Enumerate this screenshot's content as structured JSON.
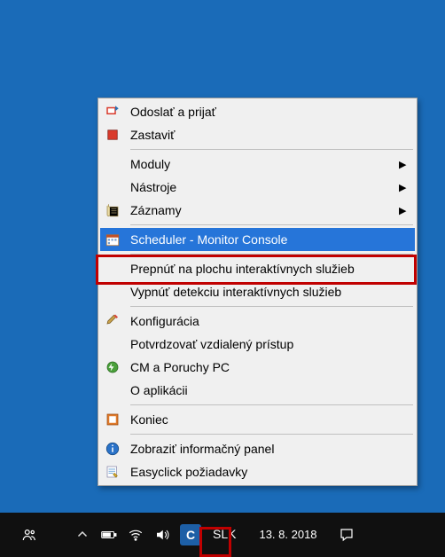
{
  "menu": {
    "items": [
      {
        "label": "Odoslať a prijať",
        "icon": "send-receive-icon",
        "submenu": false
      },
      {
        "label": "Zastaviť",
        "icon": "stop-icon",
        "submenu": false
      },
      "sep",
      {
        "label": "Moduly",
        "icon": null,
        "submenu": true
      },
      {
        "label": "Nástroje",
        "icon": null,
        "submenu": true
      },
      {
        "label": "Záznamy",
        "icon": "logs-icon",
        "submenu": true
      },
      "sep",
      {
        "label": "Scheduler - Monitor Console",
        "icon": "scheduler-icon",
        "submenu": false,
        "selected": true
      },
      "sep",
      {
        "label": "Prepnúť na plochu interaktívnych služieb",
        "icon": null,
        "submenu": false
      },
      {
        "label": "Vypnúť detekciu interaktívnych služieb",
        "icon": null,
        "submenu": false
      },
      "sep",
      {
        "label": "Konfigurácia",
        "icon": "config-icon",
        "submenu": false
      },
      {
        "label": "Potvrdzovať vzdialený prístup",
        "icon": null,
        "submenu": false
      },
      {
        "label": "CM a Poruchy PC",
        "icon": "cm-icon",
        "submenu": false
      },
      {
        "label": "O aplikácii",
        "icon": null,
        "submenu": false
      },
      "sep",
      {
        "label": "Koniec",
        "icon": "exit-icon",
        "submenu": false
      },
      "sep",
      {
        "label": "Zobraziť informačný panel",
        "icon": "info-icon",
        "submenu": false
      },
      {
        "label": "Easyclick požiadavky",
        "icon": "easyclick-icon",
        "submenu": false
      }
    ]
  },
  "taskbar": {
    "lang": "SLK",
    "date": "13. 8. 2018",
    "app_icon_letter": "C"
  }
}
